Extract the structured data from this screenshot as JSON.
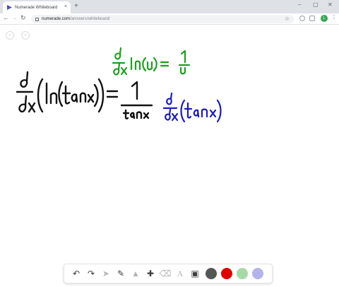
{
  "browser": {
    "tab_title": "Numerade Whiteboard",
    "tab_close": "×",
    "new_tab": "+",
    "url_host": "numerade.com",
    "url_path": "/answers/whiteboard/",
    "avatar_letter": "L",
    "window_controls": [
      "–",
      "▢",
      "✕"
    ]
  },
  "whiteboard": {
    "page_buttons": [
      "‹",
      "›"
    ]
  },
  "palette": {
    "tools": [
      {
        "name": "undo-icon",
        "glyph": "↶"
      },
      {
        "name": "redo-icon",
        "glyph": "↷"
      },
      {
        "name": "pointer-icon",
        "glyph": "➤"
      },
      {
        "name": "pen-icon",
        "glyph": "✎"
      },
      {
        "name": "shapes-icon",
        "glyph": "▲"
      },
      {
        "name": "add-icon",
        "glyph": "✚"
      },
      {
        "name": "eraser-icon",
        "glyph": "⌫"
      },
      {
        "name": "text-icon",
        "glyph": "A"
      },
      {
        "name": "image-icon",
        "glyph": "▣"
      }
    ],
    "colors": [
      "#555555",
      "#e00000",
      "#a6d9a6",
      "#b3b3ee"
    ]
  },
  "ink_colors": {
    "black": "#111111",
    "green": "#1f9e1f",
    "blue": "#1a1ac8"
  }
}
